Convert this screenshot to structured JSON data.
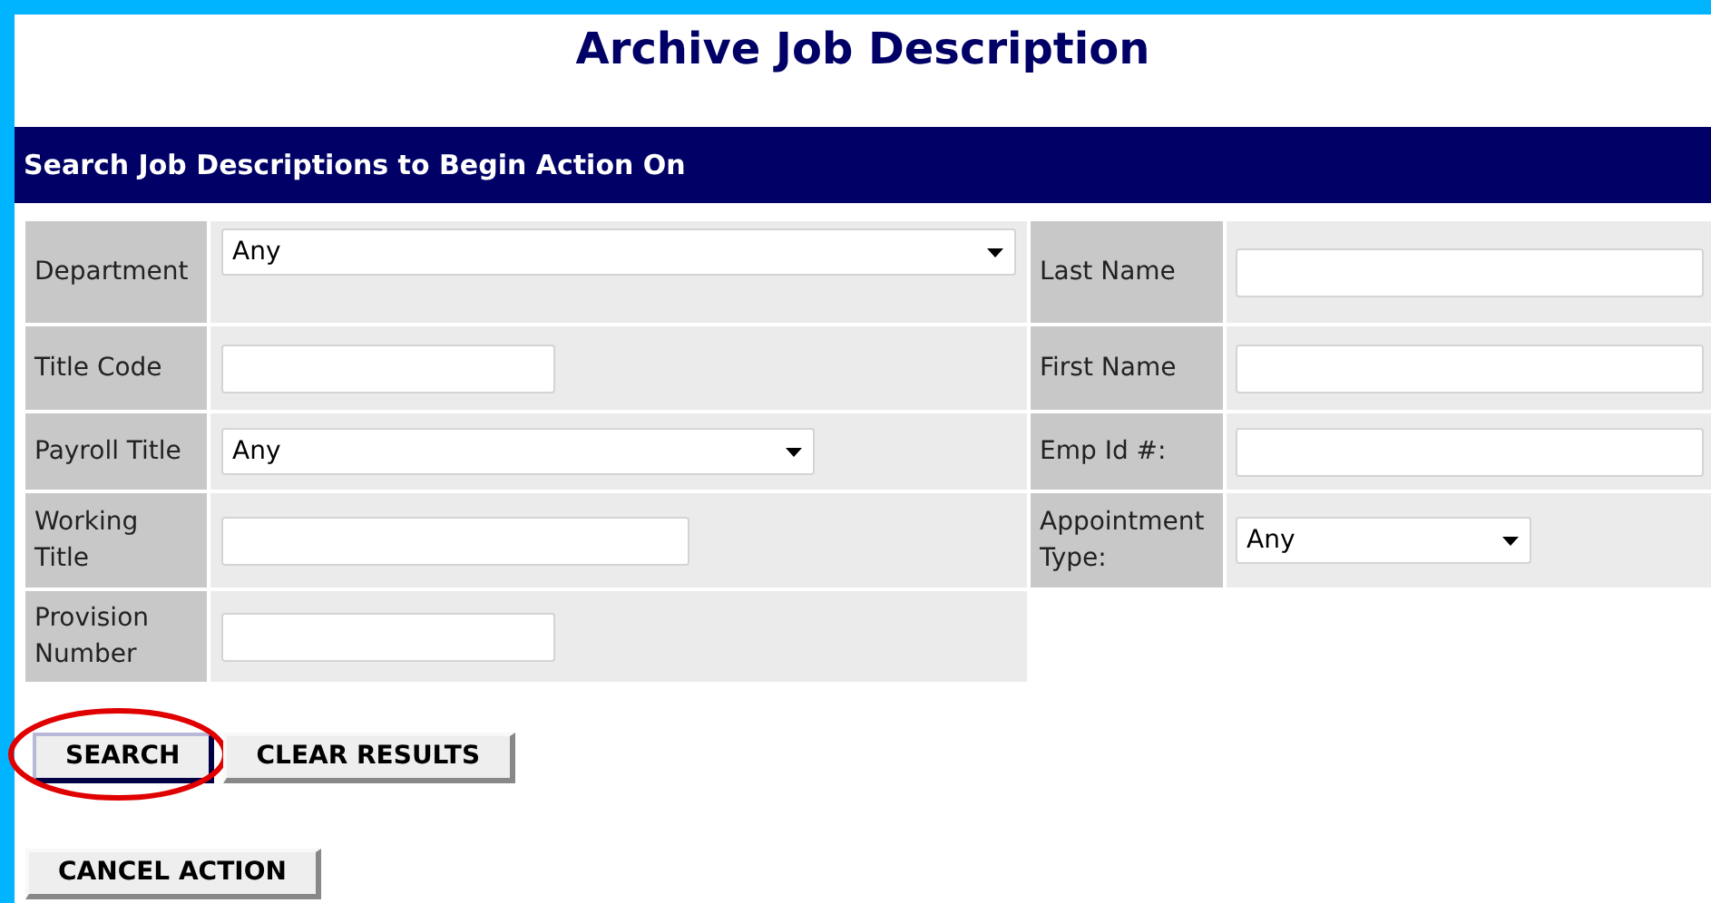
{
  "page_title": "Archive Job Description",
  "section_header": "Search Job Descriptions to Begin Action On",
  "rows": [
    {
      "left": {
        "label": "Department",
        "kind": "select",
        "value": "Any"
      },
      "right": {
        "label": "Last Name",
        "kind": "text"
      }
    },
    {
      "left": {
        "label": "Title Code",
        "kind": "text"
      },
      "right": {
        "label": "First Name",
        "kind": "text"
      }
    },
    {
      "left": {
        "label": "Payroll Title",
        "kind": "select",
        "value": "Any"
      },
      "right": {
        "label": "Emp Id #:",
        "kind": "text"
      }
    },
    {
      "left": {
        "label": "Working Title",
        "kind": "text"
      },
      "right": {
        "label": "Appointment Type:",
        "kind": "select",
        "value": "Any"
      }
    },
    {
      "left": {
        "label": "Provision Number",
        "kind": "text"
      }
    }
  ],
  "buttons": [
    {
      "label": "SEARCH",
      "highlighted": true
    },
    {
      "label": "CLEAR RESULTS",
      "highlighted": false
    }
  ],
  "cancel_button": {
    "label": "CANCEL ACTION"
  }
}
